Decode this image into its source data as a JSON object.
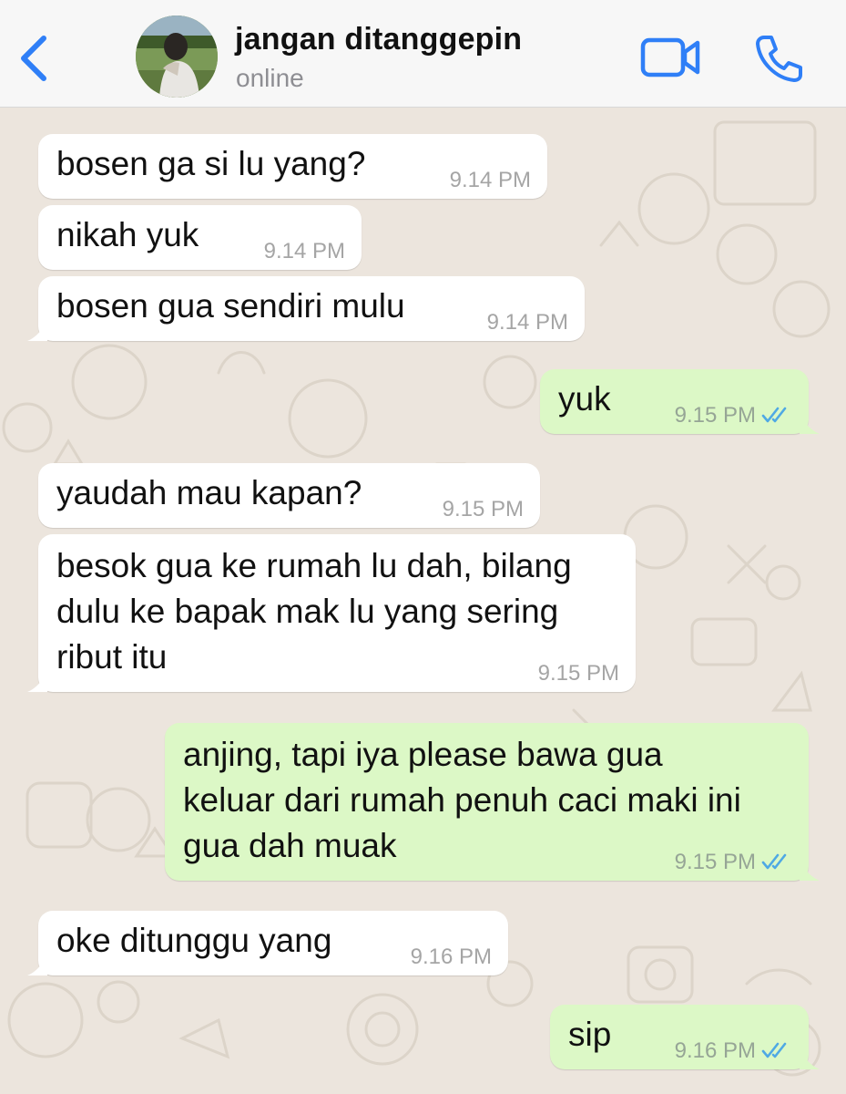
{
  "header": {
    "contact_name": "jangan ditanggepin",
    "status": "online",
    "icons": {
      "back": "chevron-left-icon",
      "video": "video-camera-icon",
      "call": "phone-icon"
    },
    "accent_color": "#2f7ff7"
  },
  "messages": [
    {
      "direction": "incoming",
      "text": "bosen ga si lu yang?",
      "time": "9.14 PM"
    },
    {
      "direction": "incoming",
      "text": "nikah yuk",
      "time": "9.14 PM"
    },
    {
      "direction": "incoming",
      "text": "bosen gua sendiri mulu",
      "time": "9.14 PM"
    },
    {
      "direction": "outgoing",
      "text": "yuk",
      "time": "9.15 PM",
      "status": "read"
    },
    {
      "direction": "incoming",
      "text": "yaudah mau kapan?",
      "time": "9.15 PM"
    },
    {
      "direction": "incoming",
      "lines": [
        "besok gua ke rumah lu dah, bilang",
        "dulu ke bapak mak lu yang sering",
        "ribut itu"
      ],
      "time": "9.15 PM"
    },
    {
      "direction": "outgoing",
      "lines": [
        "anjing, tapi iya please bawa gua",
        "keluar dari rumah penuh caci maki ini",
        "gua dah muak"
      ],
      "time": "9.15 PM",
      "status": "read"
    },
    {
      "direction": "incoming",
      "text": "oke ditunggu yang",
      "time": "9.16 PM"
    },
    {
      "direction": "outgoing",
      "text": "sip",
      "time": "9.16 PM",
      "status": "read"
    }
  ],
  "colors": {
    "incoming_bubble": "#ffffff",
    "outgoing_bubble": "#dcf8c6",
    "wallpaper": "#ece5dd",
    "read_ticks": "#4fa9e4"
  }
}
